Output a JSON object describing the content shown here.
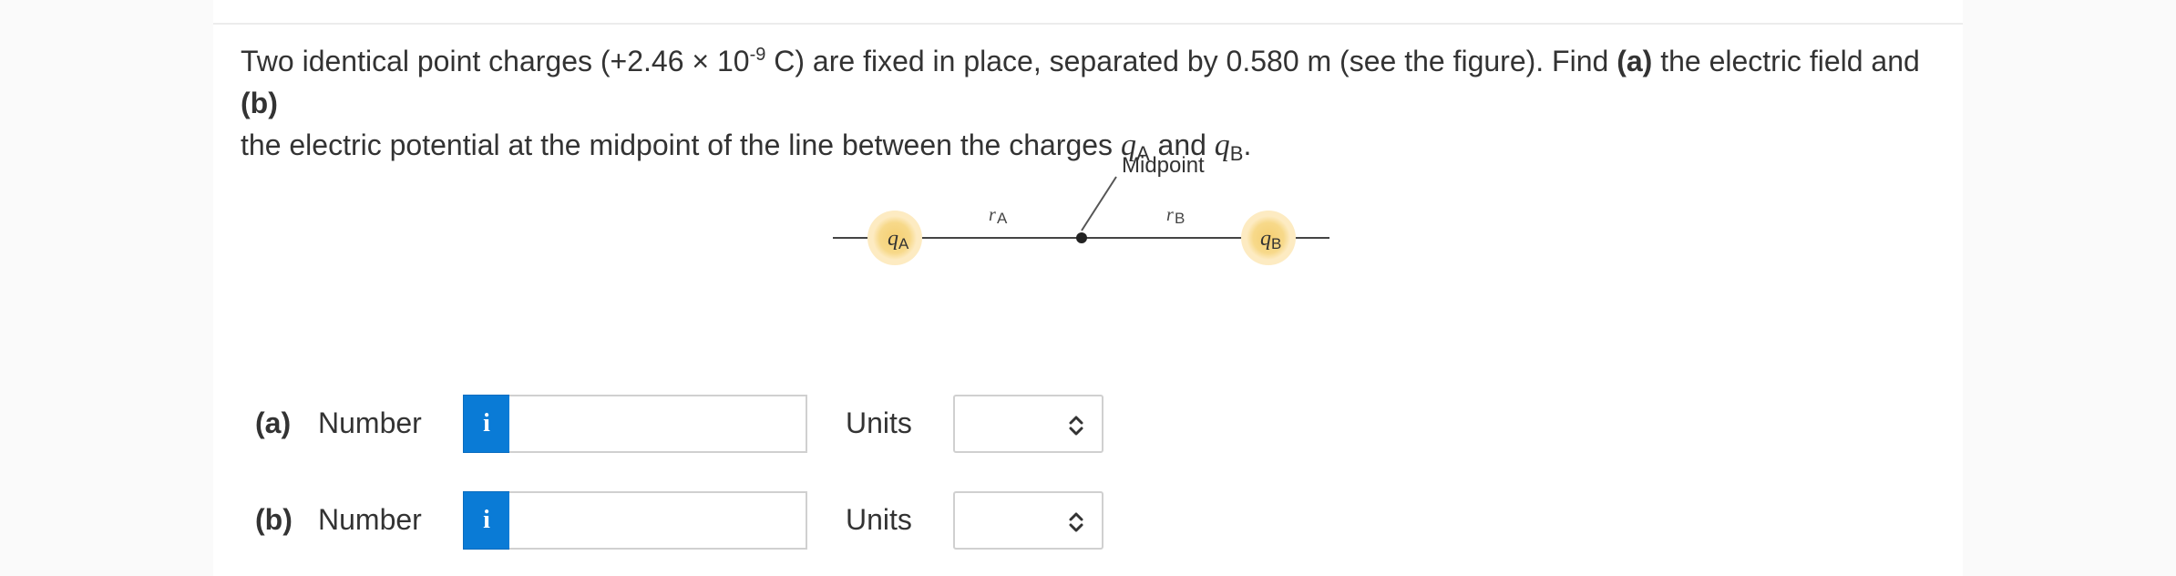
{
  "question": {
    "line1_a": "Two identical point charges (+2.46 × 10",
    "line1_exp": "-9",
    "line1_b": " C) are fixed in place, separated by 0.580 m (see the figure). Find ",
    "part_a": "(a)",
    "line1_c": " the electric field and ",
    "part_b": "(b)",
    "line2_a": "the electric potential at the midpoint of the line between the charges ",
    "qA_letter": "q",
    "qA_sub": "A",
    "and": " and ",
    "qB_letter": "q",
    "qB_sub": "B",
    "end": "."
  },
  "figure": {
    "midpoint_label": "Midpoint",
    "rA_letter": "r",
    "rA_sub": "A",
    "rB_letter": "r",
    "rB_sub": "B",
    "qA_letter": "q",
    "qA_sub": "A",
    "qB_letter": "q",
    "qB_sub": "B",
    "charge_color": "#f7d98a",
    "charge_glow": "#fdebc2"
  },
  "answers": [
    {
      "part": "(a)",
      "number_label": "Number",
      "info_icon": "i",
      "number_value": "",
      "units_label": "Units",
      "units_value": ""
    },
    {
      "part": "(b)",
      "number_label": "Number",
      "info_icon": "i",
      "number_value": "",
      "units_label": "Units",
      "units_value": ""
    }
  ]
}
